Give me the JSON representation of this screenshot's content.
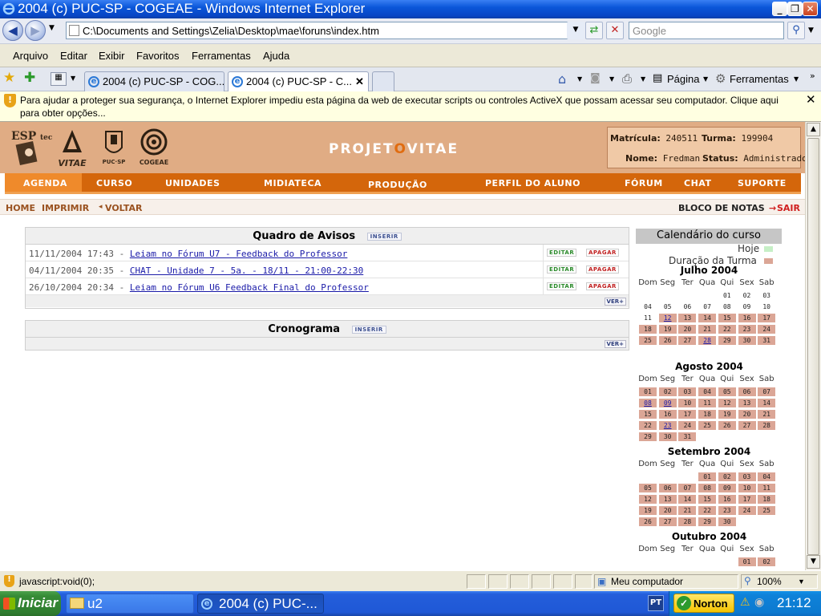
{
  "window": {
    "title": "2004 (c) PUC-SP - COGEAE - Windows Internet Explorer"
  },
  "address": {
    "url": "C:\\Documents and Settings\\Zelia\\Desktop\\mae\\foruns\\index.htm",
    "search_placeholder": "Google"
  },
  "menu": [
    "Arquivo",
    "Editar",
    "Exibir",
    "Favoritos",
    "Ferramentas",
    "Ajuda"
  ],
  "tabs": [
    "2004 (c) PUC-SP - COG...",
    "2004 (c) PUC-SP - C..."
  ],
  "commands": {
    "pagina": "Página",
    "ferramentas": "Ferramentas"
  },
  "infobar": {
    "message": "Para ajudar a proteger sua segurança, o Internet Explorer impediu esta página da web de executar scripts ou controles ActiveX que possam acessar seu computador. Clique aqui para obter opções..."
  },
  "header": {
    "logos": [
      "ESP tec",
      "VITAE",
      "PUC-SP",
      "COGEAE"
    ],
    "brand_left": "PROJET",
    "brand_o": "O",
    "brand_right": "VITAE",
    "matricula_label": "Matrícula:",
    "matricula": "240511",
    "turma_label": "Turma:",
    "turma": "199904",
    "nome_label": "Nome:",
    "nome": "Fredman",
    "status_label": "Status:",
    "status": "Administrador"
  },
  "nav": [
    "AGENDA",
    "CURSO",
    "UNIDADES",
    "MIDIATECA",
    "PRODUÇÃO",
    "PERFIL DO ALUNO",
    "FÓRUM",
    "CHAT",
    "SUPORTE"
  ],
  "subnav": {
    "home": "HOME",
    "imprimir": "IMPRIMIR",
    "voltar": "VOLTAR",
    "bloco": "BLOCO DE NOTAS",
    "sair": "SAIR"
  },
  "avisos": {
    "title": "Quadro de Avisos",
    "inserir": "INSERIR",
    "editar": "EDITAR",
    "apagar": "APAGAR",
    "ver": "VER+",
    "items": [
      {
        "date": "11/11/2004 17:43",
        "text": "Leiam no Fórum U7 - Feedback do Professor"
      },
      {
        "date": "04/11/2004 20:35",
        "text": "CHAT - Unidade 7 - 5a. - 18/11 - 21:00-22:30"
      },
      {
        "date": "26/10/2004 20:34",
        "text": "Leiam no Fórum U6 Feedback Final do Professor"
      }
    ]
  },
  "cronograma": {
    "title": "Cronograma",
    "inserir": "INSERIR",
    "ver": "VER+"
  },
  "calendar": {
    "title": "Calendário do curso",
    "legend_hoje": "Hoje",
    "legend_duracao": "Duração da Turma",
    "hoje_color": "#c6efc6",
    "duracao_color": "#dba696",
    "weekdays": [
      "Dom",
      "Seg",
      "Ter",
      "Qua",
      "Qui",
      "Sex",
      "Sab"
    ],
    "months": [
      {
        "name": "Julho 2004",
        "first_dow": 4,
        "days": 31,
        "visible": 31,
        "course_from": 12,
        "links": [
          12,
          28
        ]
      },
      {
        "name": "Agosto 2004",
        "first_dow": 0,
        "days": 31,
        "visible": 31,
        "course_from": 1,
        "links": [
          8,
          9,
          23
        ]
      },
      {
        "name": "Setembro 2004",
        "first_dow": 3,
        "days": 30,
        "visible": 30,
        "course_from": 1,
        "links": []
      },
      {
        "name": "Outubro 2004",
        "first_dow": 5,
        "days": 31,
        "visible": 2,
        "course_from": 1,
        "links": []
      }
    ]
  },
  "statusbar": {
    "text": "javascript:void(0);",
    "zone": "Meu computador",
    "zoom": "100%"
  },
  "taskbar": {
    "start": "Iniciar",
    "tasks": [
      "u2",
      "2004 (c) PUC-..."
    ],
    "lang": "PT",
    "norton": "Norton",
    "time": "21:12"
  }
}
